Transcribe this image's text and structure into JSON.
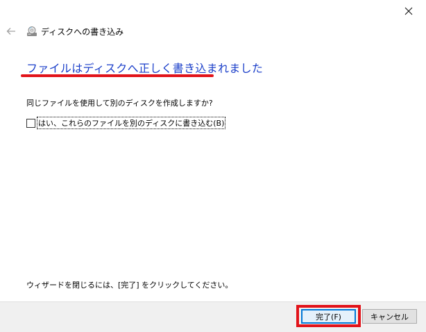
{
  "window": {
    "title": "ディスクへの書き込み"
  },
  "heading": "ファイルはディスクへ正しく書き込まれました",
  "question": "同じファイルを使用して別のディスクを作成しますか?",
  "checkbox": {
    "label": "はい、これらのファイルを別のディスクに書き込む(B)",
    "checked": false
  },
  "footer": "ウィザードを閉じるには、[完了] をクリックしてください。",
  "buttons": {
    "finish": "完了(F)",
    "cancel": "キャンセル"
  },
  "colors": {
    "heading": "#1a3ec9",
    "highlight": "#e2131a",
    "focus_border": "#0078d7"
  },
  "icons": {
    "close": "close-icon",
    "back": "back-arrow-icon",
    "disc": "disc-burn-icon"
  }
}
